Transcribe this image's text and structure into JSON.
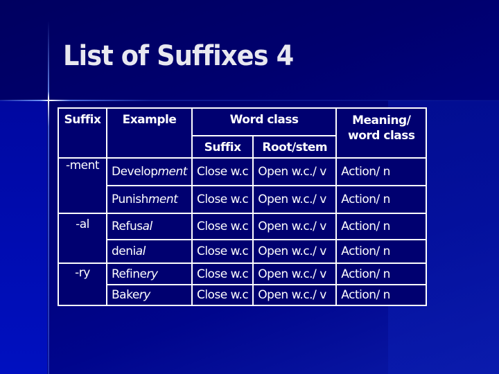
{
  "slide": {
    "title": "List of Suffixes 4",
    "colors": {
      "background": "#000066",
      "table_cell": "#000070",
      "border": "#ffffff",
      "text": "#ffffff"
    }
  },
  "table": {
    "headers": {
      "suffix": "Suffix",
      "example": "Example",
      "word_class": "Word class",
      "word_class_suffix": "Suffix",
      "word_class_root": "Root/stem",
      "meaning": "Meaning/ word class"
    },
    "groups": [
      {
        "suffix": "-ment",
        "rows": [
          {
            "example_stem": "Develop",
            "example_suffix": "ment",
            "suffix_class": "Close w.c",
            "root_class": "Open w.c./ v",
            "meaning": "Action/ n"
          },
          {
            "example_stem": "Punish",
            "example_suffix": "ment",
            "suffix_class": "Close w.c",
            "root_class": "Open w.c./ v",
            "meaning": "Action/ n"
          }
        ]
      },
      {
        "suffix": "-al",
        "rows": [
          {
            "example_stem": "Refus",
            "example_suffix": "al",
            "suffix_class": "Close w.c",
            "root_class": "Open w.c./ v",
            "meaning": "Action/ n"
          },
          {
            "example_stem": "deni",
            "example_suffix": "al",
            "suffix_class": "Close w.c",
            "root_class": "Open w.c./ v",
            "meaning": "Action/ n"
          }
        ]
      },
      {
        "suffix": "-ry",
        "rows": [
          {
            "example_stem": "Refine",
            "example_suffix": "ry",
            "suffix_class": "Close w.c",
            "root_class": "Open w.c./ v",
            "meaning": "Action/ n"
          },
          {
            "example_stem": "Bake",
            "example_suffix": "ry",
            "suffix_class": "Close w.c",
            "root_class": "Open w.c./ v",
            "meaning": "Action/ n"
          }
        ]
      }
    ]
  }
}
